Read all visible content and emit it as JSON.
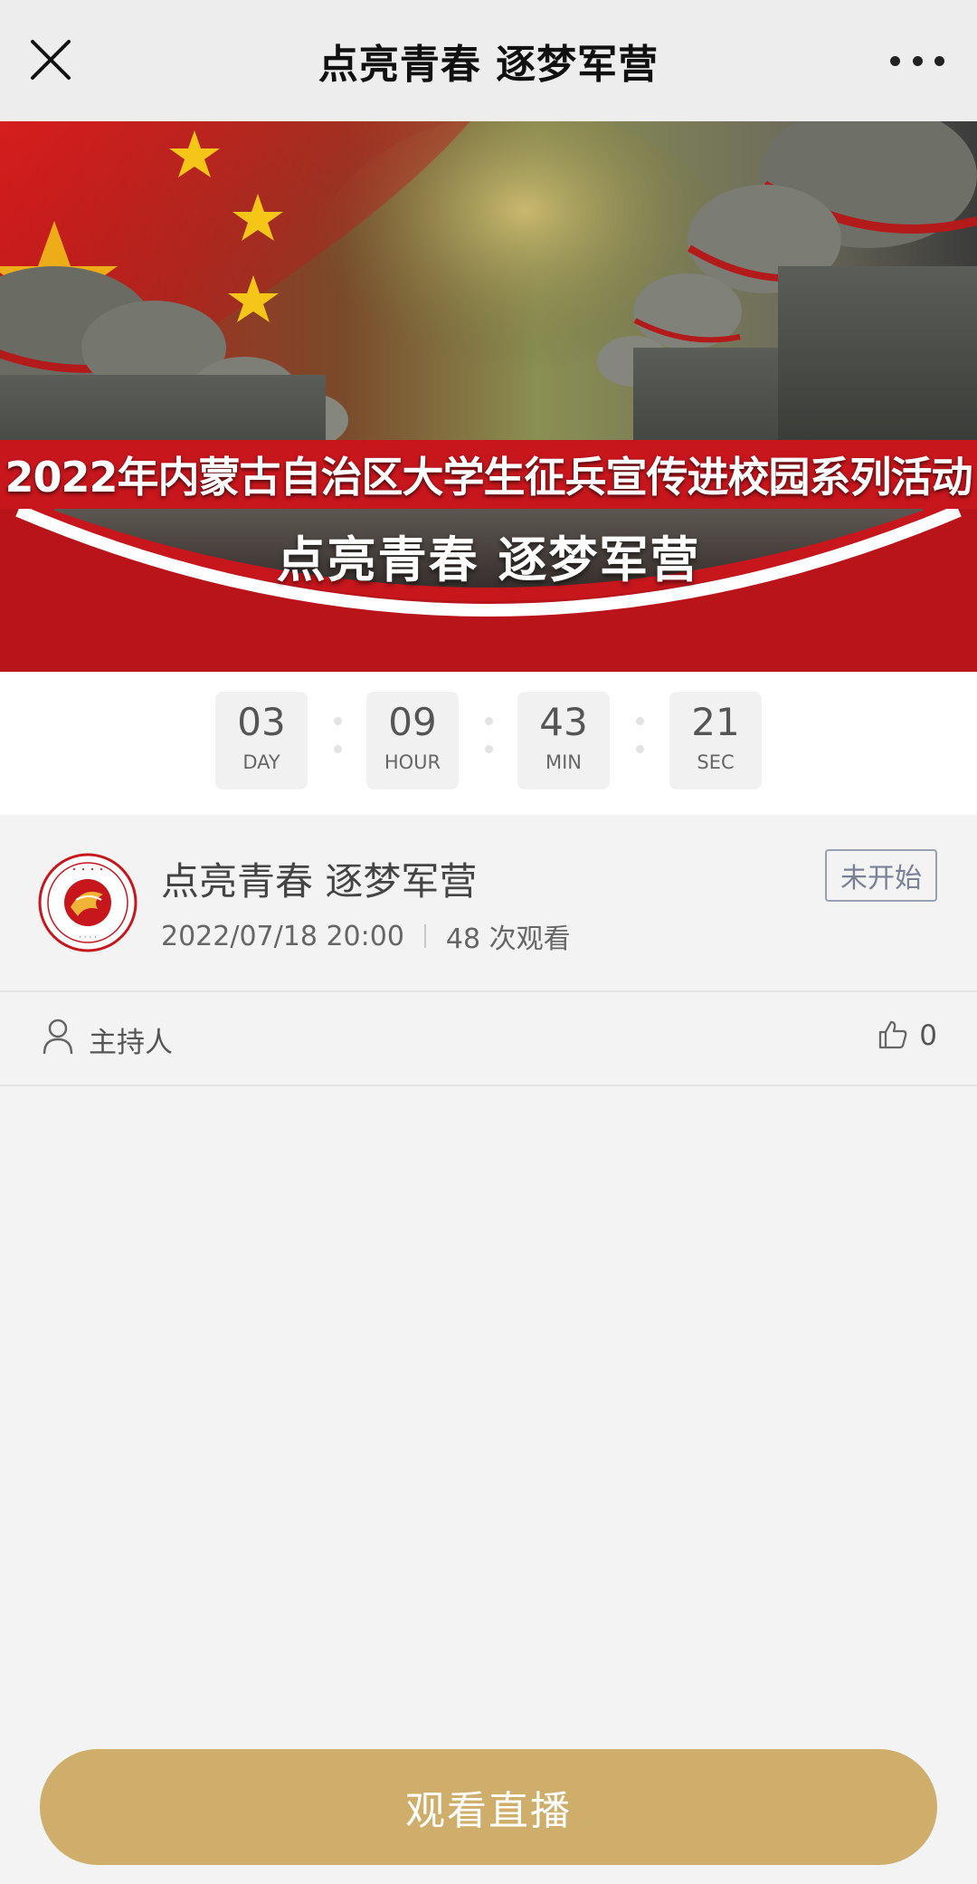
{
  "nav": {
    "title": "点亮青春 逐梦军营",
    "close_icon": "close-icon",
    "more_icon": "more-dots-icon"
  },
  "banner": {
    "ribbon_text": "2022年内蒙古自治区大学生征兵宣传进校园系列活动",
    "subtitle": "点亮青春  逐梦军营"
  },
  "countdown": {
    "units": [
      {
        "value": "03",
        "label": "DAY"
      },
      {
        "value": "09",
        "label": "HOUR"
      },
      {
        "value": "43",
        "label": "MIN"
      },
      {
        "value": "21",
        "label": "SEC"
      }
    ]
  },
  "info": {
    "title": "点亮青春 逐梦军营",
    "datetime": "2022/07/18 20:00",
    "views": "48 次观看",
    "status": "未开始"
  },
  "host": {
    "label": "主持人",
    "likes": "0"
  },
  "watch_button": "观看直播",
  "colors": {
    "accent": "#cfad6a",
    "banner_red": "#c8161d",
    "status_border": "#9aa0b4"
  }
}
